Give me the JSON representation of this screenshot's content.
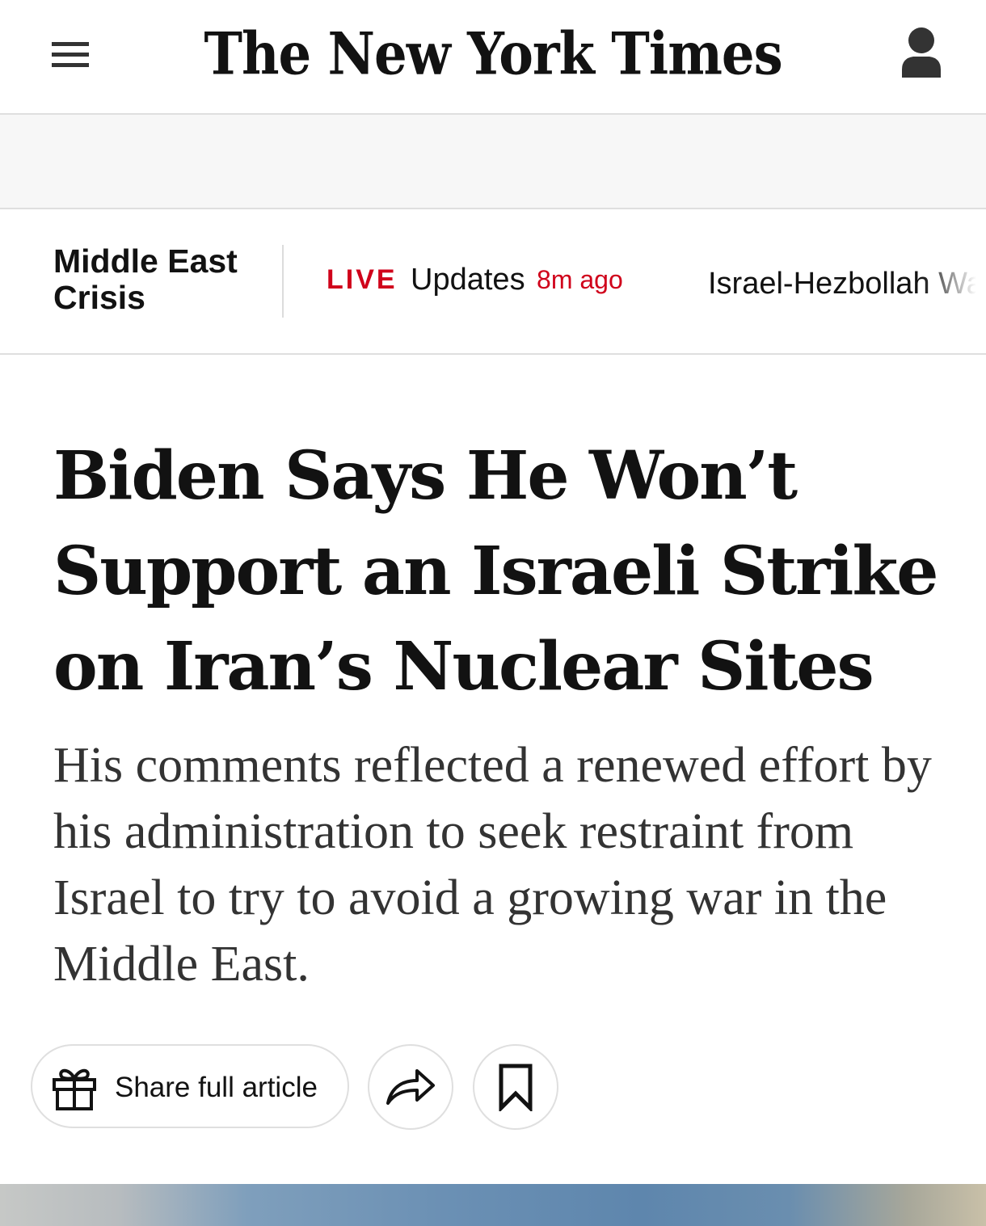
{
  "header": {
    "logo_text": "The New York Times",
    "menu_icon": "hamburger-menu-icon",
    "account_icon": "user-account-icon"
  },
  "subnav": {
    "section_label": "Middle East Crisis",
    "live_tag": "LIVE",
    "live_label": "Updates",
    "live_time": "8m ago",
    "next_link": "Israel-Hezbollah War"
  },
  "article": {
    "headline": "Biden Says He Won’t Support an Israeli Strike on Iran’s Nuclear Sites",
    "summary": "His comments reflected a renewed effort by his administration to seek restraint from Israel to try to avoid a growing war in the Middle East."
  },
  "actions": {
    "share_full_label": "Share full article",
    "gift_icon": "gift-icon",
    "share_icon": "share-arrow-icon",
    "save_icon": "bookmark-icon"
  },
  "colors": {
    "live_red": "#d0021b",
    "text_dark": "#121212",
    "border_gray": "#dfdfdf"
  }
}
